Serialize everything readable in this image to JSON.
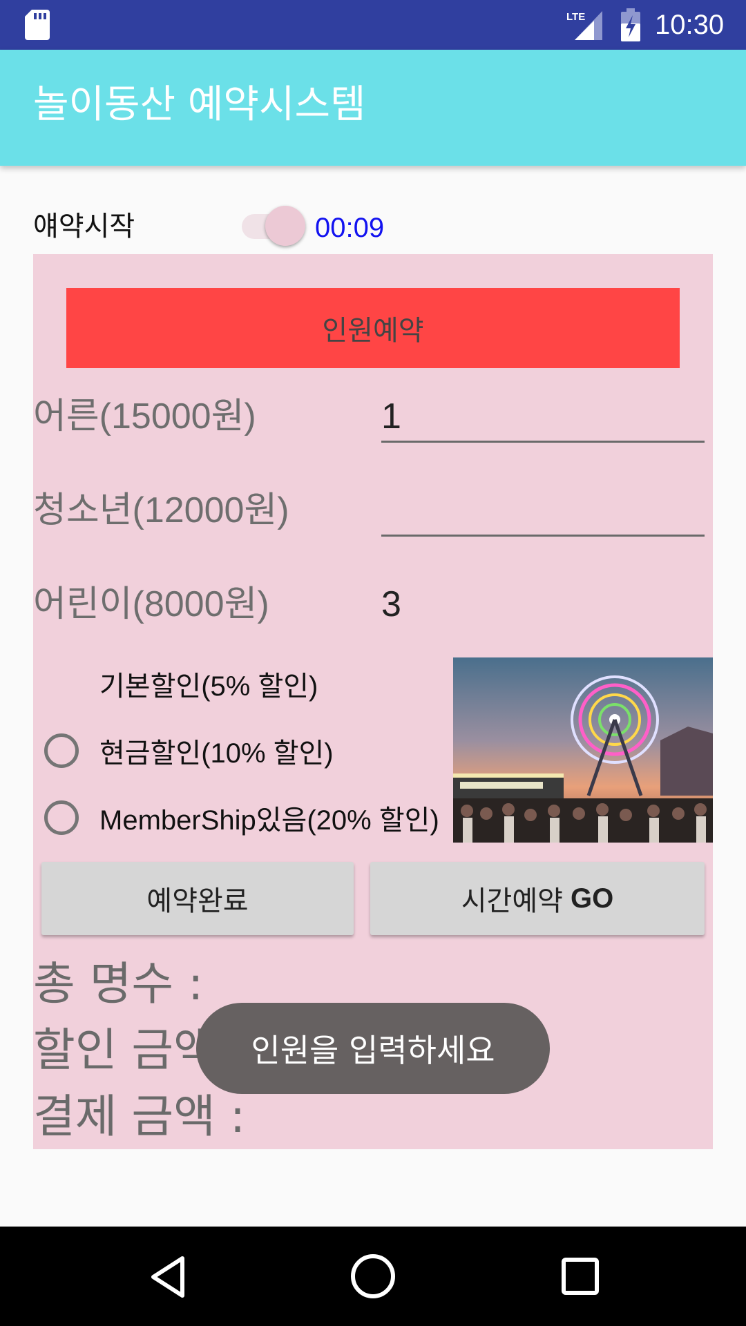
{
  "status_bar": {
    "network": "LTE",
    "time": "10:30",
    "icons": [
      "sd-card-icon",
      "signal-icon",
      "battery-icon"
    ]
  },
  "app_bar": {
    "title": "놀이동산 예약시스템"
  },
  "start_row": {
    "label": "얘약시작",
    "switch_on": true,
    "timer": "00:09"
  },
  "panel": {
    "reserve_button": "인원예약",
    "rows": [
      {
        "label": "어른(15000원)",
        "value": "1"
      },
      {
        "label": "청소년(12000원)",
        "value": ""
      },
      {
        "label": "어린이(8000원)",
        "value": "3"
      }
    ],
    "discounts": [
      {
        "label": "기본할인(5% 할인)"
      },
      {
        "label": "현금할인(10% 할인)",
        "checked": false
      },
      {
        "label": "MemberShip있음(20% 할인)",
        "checked": false
      }
    ],
    "image": "ferris-wheel-photo",
    "buttons": {
      "complete": "예약완료",
      "time_reserve": "시간예약",
      "time_reserve_go": "GO"
    },
    "summary": {
      "total_count": "총 명수 :",
      "discount_amount": "할인 금액 :",
      "payment_amount": "결제 금액 :"
    }
  },
  "toast": {
    "message": "인원을 입력하세요"
  },
  "colors": {
    "status_bar": "#303f9f",
    "app_bar": "#6be0e8",
    "panel": "#f1d0db",
    "reserve_button": "#ff4545",
    "timer": "#1212f0",
    "toast": "#666161"
  }
}
